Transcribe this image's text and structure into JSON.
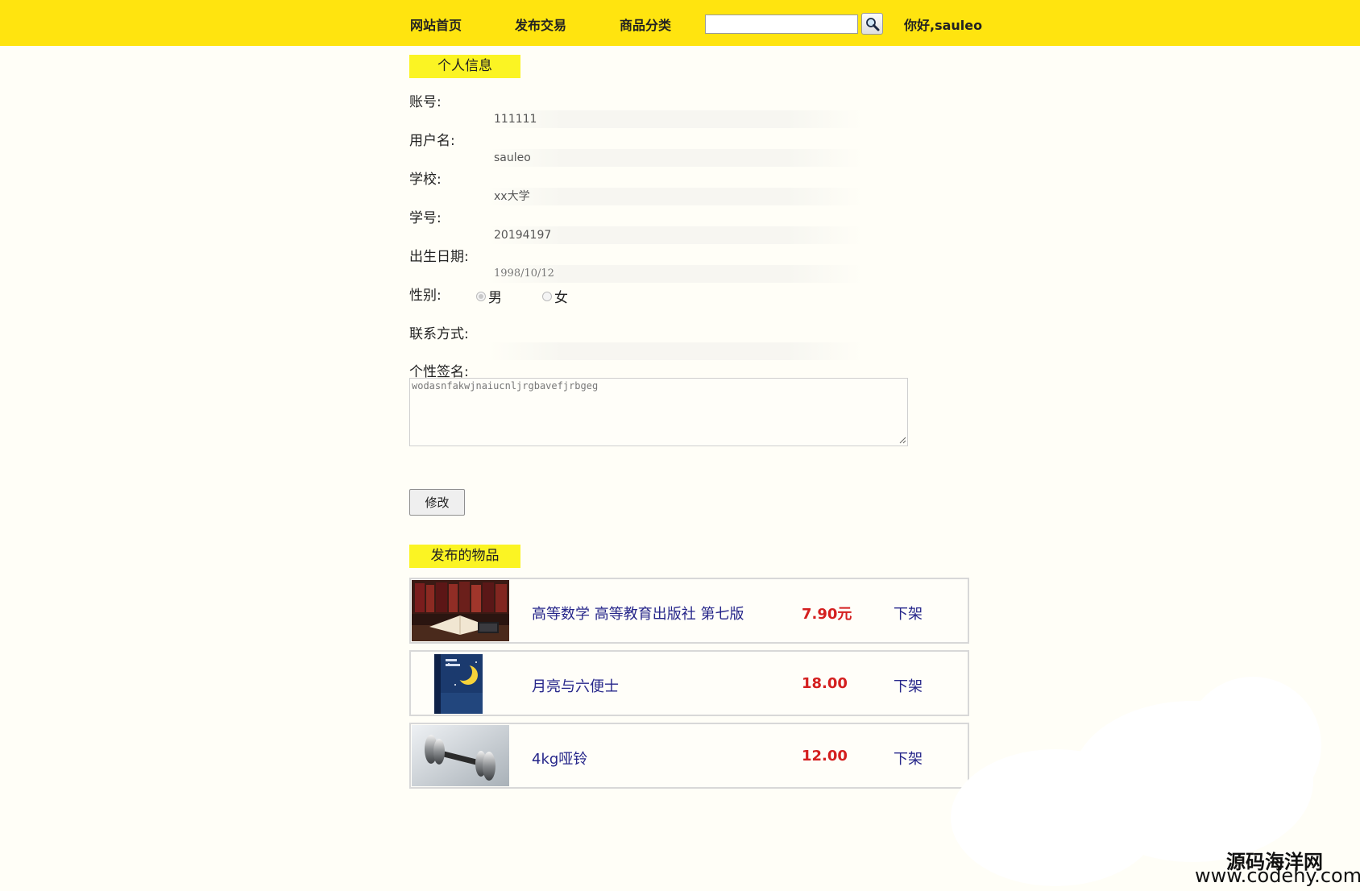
{
  "header": {
    "nav": [
      "网站首页",
      "发布交易",
      "商品分类"
    ],
    "search_placeholder": "",
    "greeting": "你好,sauleo"
  },
  "profile": {
    "section_title": "个人信息",
    "fields": [
      {
        "label": "账号:",
        "value": "111111"
      },
      {
        "label": "用户名:",
        "value": "sauleo"
      },
      {
        "label": "学校:",
        "value": "xx大学"
      },
      {
        "label": "学号:",
        "value": "20194197"
      },
      {
        "label": "出生日期:",
        "value": "1998/10/12"
      }
    ],
    "gender_label": "性别:",
    "gender_options": [
      "男",
      "女"
    ],
    "gender_selected": "男",
    "contact_label": "联系方式:",
    "contact_value": "",
    "signature_label": "个性签名:",
    "signature_value": "wodasnfakwjnaiucnljrgbavefjrbgeg",
    "edit_button": "修改"
  },
  "published": {
    "section_title": "发布的物品",
    "items": [
      {
        "title": "高等数学 高等教育出版社 第七版",
        "price": "7.90元",
        "action": "下架",
        "thumb": "books-image"
      },
      {
        "title": "月亮与六便士",
        "price": "18.00",
        "action": "下架",
        "thumb": "book-cover-image"
      },
      {
        "title": "4kg哑铃",
        "price": "12.00",
        "action": "下架",
        "thumb": "dumbbell-image"
      }
    ]
  },
  "watermark": {
    "name": "源码海洋网",
    "url": "www.codehy.com"
  },
  "colors": {
    "header_bg": "#ffe40f",
    "section_bg": "#fbf423",
    "price": "#d41f1f",
    "link": "#26268a"
  }
}
